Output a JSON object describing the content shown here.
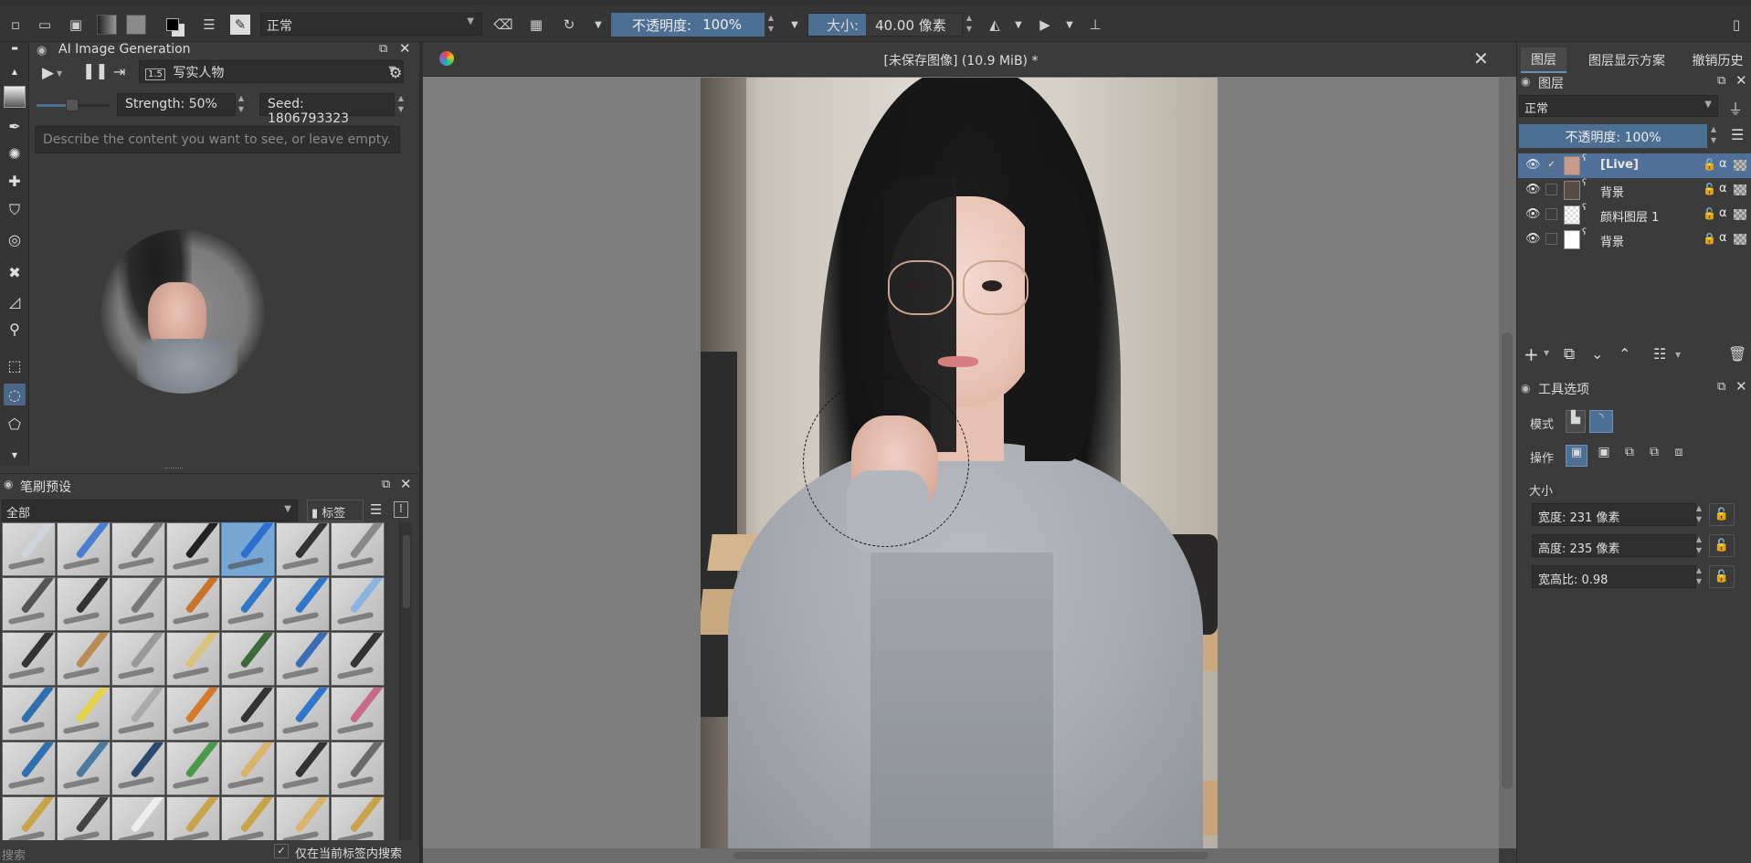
{
  "toolbar": {
    "blend_mode": "正常",
    "opacity_label": "不透明度:",
    "opacity_value": "100%",
    "size_label": "大小:",
    "size_value": "40.00 像素"
  },
  "ai_panel": {
    "title": "AI Image Generation",
    "style_badge": "1.5",
    "style_name": "写实人物",
    "strength": "Strength: 50%",
    "seed": "Seed: 1806793323",
    "prompt_placeholder": "Describe the content you want to see, or leave empty."
  },
  "brush_panel": {
    "title": "笔刷预设",
    "filter": "全部",
    "tag_label": "标签",
    "search_placeholder": "搜索",
    "checkbox_label": "仅在当前标签内搜索",
    "brush_count": 42,
    "selected_index": 4
  },
  "document": {
    "title": "[未保存图像]  (10.9 MiB) *"
  },
  "right_tabs": [
    "图层",
    "图层显示方案",
    "撤销历史"
  ],
  "layers_panel": {
    "title": "图层",
    "blend_mode": "正常",
    "opacity": "不透明度:  100%",
    "layers": [
      {
        "name": "[Live]",
        "selected": true
      },
      {
        "name": "背景",
        "selected": false
      },
      {
        "name": "颜料图层 1",
        "selected": false
      },
      {
        "name": "背景",
        "selected": false
      }
    ]
  },
  "tool_options": {
    "title": "工具选项",
    "mode_label": "模式",
    "operation_label": "操作",
    "size_label": "大小",
    "width": "宽度:  231 像素",
    "height": "高度:  235 像素",
    "ratio": "宽高比:  0.98"
  },
  "colors": {
    "accent": "#4d6f94",
    "layer_selected": "#50709a",
    "canvas_bg": "#7e7e7e",
    "panel_bg": "#3b3b3b"
  }
}
